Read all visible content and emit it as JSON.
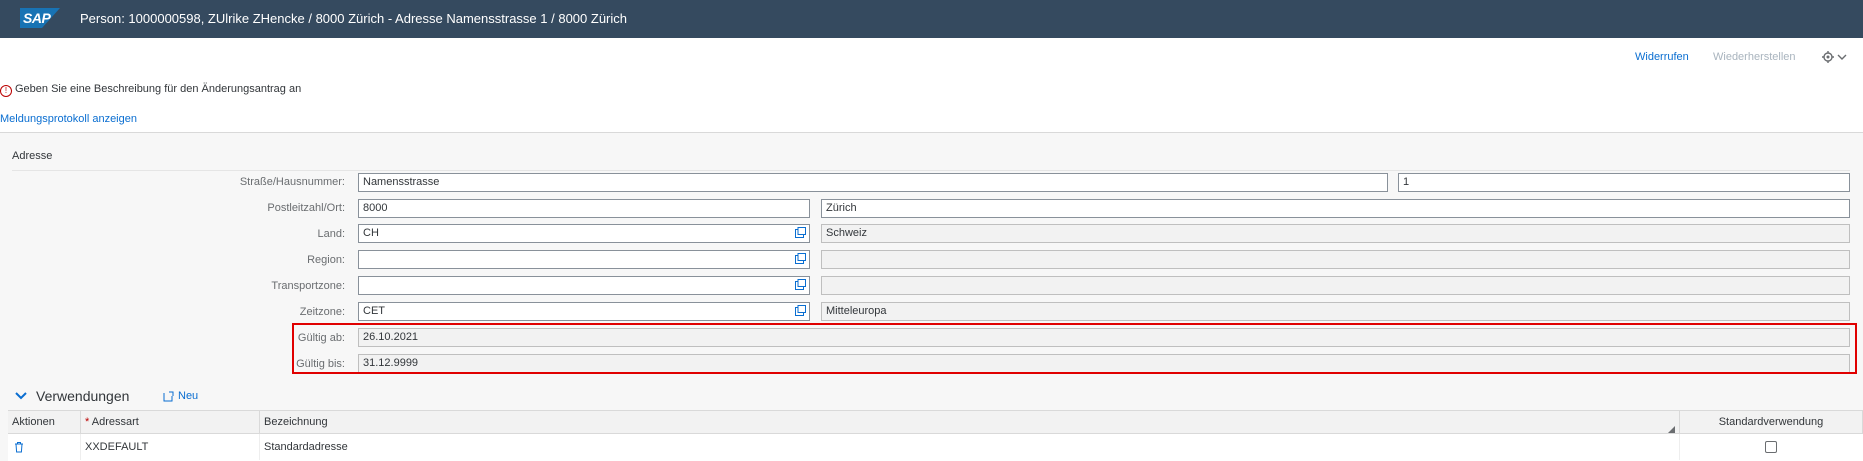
{
  "shell": {
    "logo": "SAP",
    "title": "Person: 1000000598, ZUlrike ZHencke / 8000 Zürich - Adresse Namensstrasse 1 / 8000 Zürich"
  },
  "toolbar": {
    "undo": "Widerrufen",
    "redo": "Wiederherstellen"
  },
  "message": {
    "text": "Geben Sie eine Beschreibung für den Änderungsantrag an",
    "link": "Meldungsprotokoll anzeigen"
  },
  "section_title": "Adresse",
  "form": {
    "street_label": "Straße/Hausnummer:",
    "street": "Namensstrasse",
    "house_number": "1",
    "postal_label": "Postleitzahl/Ort:",
    "postal_code": "8000",
    "city": "Zürich",
    "country_label": "Land:",
    "country": "CH",
    "country_text": "Schweiz",
    "region_label": "Region:",
    "region": "",
    "region_text": "",
    "transport_label": "Transportzone:",
    "transport": "",
    "transport_text": "",
    "timezone_label": "Zeitzone:",
    "timezone": "CET",
    "timezone_text": "Mitteleuropa",
    "valid_from_label": "Gültig ab:",
    "valid_from": "26.10.2021",
    "valid_to_label": "Gültig bis:",
    "valid_to": "31.12.9999"
  },
  "usage": {
    "title": "Verwendungen",
    "new_label": "Neu",
    "columns": [
      "Aktionen",
      "Adressart",
      "Bezeichnung",
      "Standardverwendung"
    ],
    "required_marker": "*",
    "rows": [
      {
        "type": "XXDEFAULT",
        "description": "Standardadresse"
      }
    ]
  },
  "colors": {
    "shell": "#354a5f",
    "link": "#0a6ed1",
    "error": "#bb0000",
    "highlight_box": "#e00000"
  }
}
